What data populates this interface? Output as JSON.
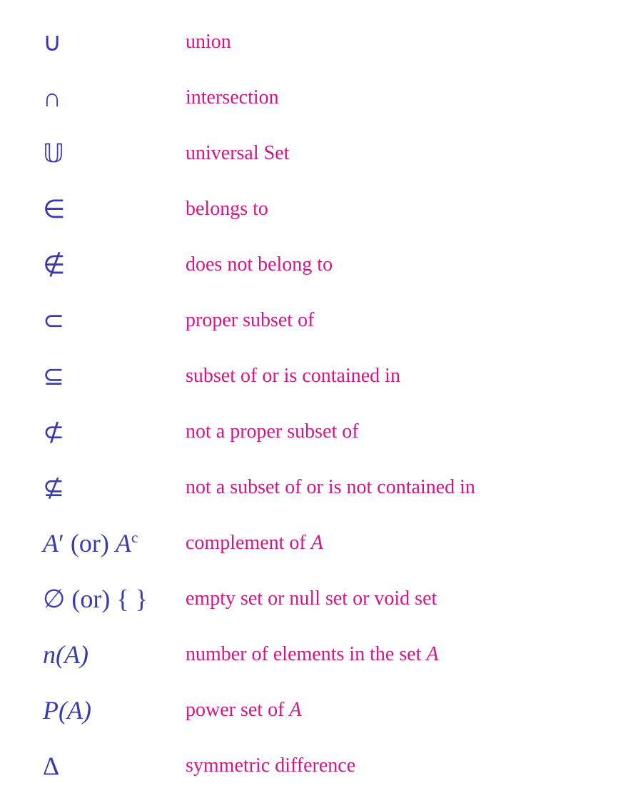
{
  "rows": [
    {
      "symbol": "∪",
      "description": "union",
      "symbol_style": "normal",
      "desc_has_italic": false
    },
    {
      "symbol": "∩",
      "description": "intersection",
      "symbol_style": "normal",
      "desc_has_italic": false
    },
    {
      "symbol": "𝕌",
      "description": "universal Set",
      "symbol_style": "normal",
      "desc_has_italic": false
    },
    {
      "symbol": "∈",
      "description": "belongs to",
      "symbol_style": "normal",
      "desc_has_italic": false
    },
    {
      "symbol": "∉",
      "description": "does not belong to",
      "symbol_style": "normal",
      "desc_has_italic": false
    },
    {
      "symbol": "⊂",
      "description": "proper subset of",
      "symbol_style": "normal",
      "desc_has_italic": false
    },
    {
      "symbol": "⊆",
      "description": "subset of  or  is contained in",
      "symbol_style": "normal",
      "desc_has_italic": false
    },
    {
      "symbol": "⊄",
      "description": "not a proper subset of",
      "symbol_style": "normal",
      "desc_has_italic": false
    },
    {
      "symbol": "⊄",
      "description": "not a subset of  or  is not contained in",
      "symbol_style": "normal",
      "desc_has_italic": false
    },
    {
      "symbol": "A′ (or) Aᶜ",
      "description": "complement of A",
      "symbol_style": "italic",
      "desc_has_italic": true,
      "desc_template": "complement_of_A"
    },
    {
      "symbol": "∅ (or) { }",
      "description": "empty set or null set or void set",
      "symbol_style": "normal",
      "desc_has_italic": false
    },
    {
      "symbol": "n(A)",
      "description": "number of elements in the set A",
      "symbol_style": "italic",
      "desc_has_italic": true,
      "desc_template": "nA"
    },
    {
      "symbol": "P(A)",
      "description": "power set of A",
      "symbol_style": "italic",
      "desc_has_italic": true,
      "desc_template": "PA"
    },
    {
      "symbol": "Δ",
      "description": "symmetric difference",
      "symbol_style": "normal",
      "desc_has_italic": false
    }
  ],
  "colors": {
    "symbol": "#3a3ab0",
    "description": "#d61585"
  }
}
